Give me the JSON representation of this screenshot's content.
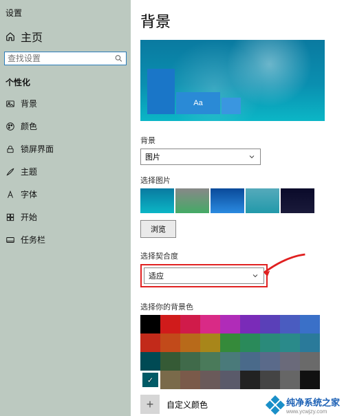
{
  "sidebar": {
    "app": "设置",
    "home": "主页",
    "search_placeholder": "查找设置",
    "section": "个性化",
    "items": [
      {
        "icon": "picture",
        "label": "背景"
      },
      {
        "icon": "palette",
        "label": "颜色"
      },
      {
        "icon": "lock",
        "label": "锁屏界面"
      },
      {
        "icon": "brush",
        "label": "主题"
      },
      {
        "icon": "font",
        "label": "字体"
      },
      {
        "icon": "grid",
        "label": "开始"
      },
      {
        "icon": "taskbar",
        "label": "任务栏"
      }
    ]
  },
  "main": {
    "title": "背景",
    "preview_sample": "Aa",
    "bg_label": "背景",
    "bg_value": "图片",
    "pick_label": "选择图片",
    "browse": "浏览",
    "fit_label": "选择契合度",
    "fit_value": "适应",
    "bgcolor_label": "选择你的背景色",
    "custom_color": "自定义颜色"
  },
  "swatch_colors": [
    "#000000",
    "#d01b1b",
    "#d01b4a",
    "#d92a86",
    "#b02cb8",
    "#7a2bb8",
    "#5a40b8",
    "#4a5cc0",
    "#3a70c8",
    "#c22a1a",
    "#c24a1a",
    "#b86a1a",
    "#a8861a",
    "#358a3a",
    "#2a8a5a",
    "#2a8a7a",
    "#2a8a8a",
    "#2a7a9a",
    "#004a54",
    "#355a35",
    "#406a4a",
    "#4a7a5a",
    "#4a7a7a",
    "#4a6a8a",
    "#5a6a8a",
    "#6a6a7a",
    "#6a6a6a",
    "#005a66",
    "#7a6a4a",
    "#7a5a4a",
    "#6a5a5a",
    "#5a5a6a",
    "#222222",
    "#444444",
    "#666666",
    "#111111"
  ],
  "selected_swatch_index": 27,
  "watermark": {
    "brand": "纯净系统之家",
    "url": "www.ycwjzy.com"
  }
}
